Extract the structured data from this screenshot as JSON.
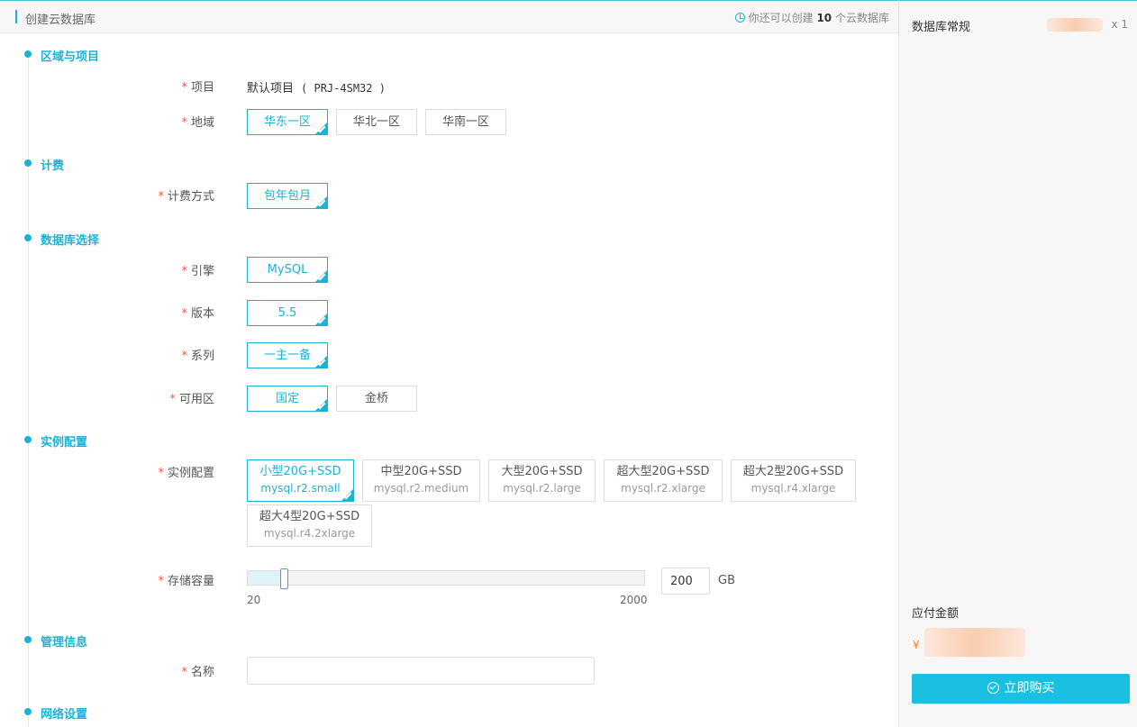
{
  "header": {
    "title": "创建云数据库",
    "quota_prefix": "你还可以创建",
    "quota_count": "10",
    "quota_suffix": "个云数据库"
  },
  "sections": {
    "region_project": "区域与项目",
    "billing": "计费",
    "database": "数据库选择",
    "instance": "实例配置",
    "management": "管理信息",
    "network": "网络设置"
  },
  "fields": {
    "project": {
      "label": "项目",
      "value": "默认项目",
      "code": "( PRJ-4SM32 )"
    },
    "region": {
      "label": "地域",
      "options": [
        "华东一区",
        "华北一区",
        "华南一区"
      ],
      "selected": "华东一区"
    },
    "billing_method": {
      "label": "计费方式",
      "options": [
        "包年包月"
      ],
      "selected": "包年包月"
    },
    "engine": {
      "label": "引擎",
      "options": [
        "MySQL"
      ],
      "selected": "MySQL"
    },
    "version": {
      "label": "版本",
      "options": [
        "5.5"
      ],
      "selected": "5.5"
    },
    "series": {
      "label": "系列",
      "options": [
        "一主一备"
      ],
      "selected": "一主一备"
    },
    "zone": {
      "label": "可用区",
      "options": [
        "国定",
        "金桥"
      ],
      "selected": "国定"
    },
    "instance_config": {
      "label": "实例配置",
      "options": [
        {
          "name": "小型20G+SSD",
          "code": "mysql.r2.small"
        },
        {
          "name": "中型20G+SSD",
          "code": "mysql.r2.medium"
        },
        {
          "name": "大型20G+SSD",
          "code": "mysql.r2.large"
        },
        {
          "name": "超大型20G+SSD",
          "code": "mysql.r2.xlarge"
        },
        {
          "name": "超大2型20G+SSD",
          "code": "mysql.r4.xlarge"
        },
        {
          "name": "超大4型20G+SSD",
          "code": "mysql.r4.2xlarge"
        }
      ],
      "selected": "小型20G+SSD"
    },
    "storage": {
      "label": "存储容量",
      "min": "20",
      "max": "2000",
      "value": "200",
      "unit": "GB",
      "fraction": 0.091
    },
    "name": {
      "label": "名称",
      "value": ""
    }
  },
  "sidebar": {
    "spec_label": "数据库常规",
    "quantity": "x 1",
    "pay_label": "应付金额",
    "currency": "¥",
    "buy_label": "立即购买"
  },
  "colors": {
    "accent": "#1ab3d6",
    "required": "#e85b4a",
    "buy_button": "#1ac0e0"
  }
}
